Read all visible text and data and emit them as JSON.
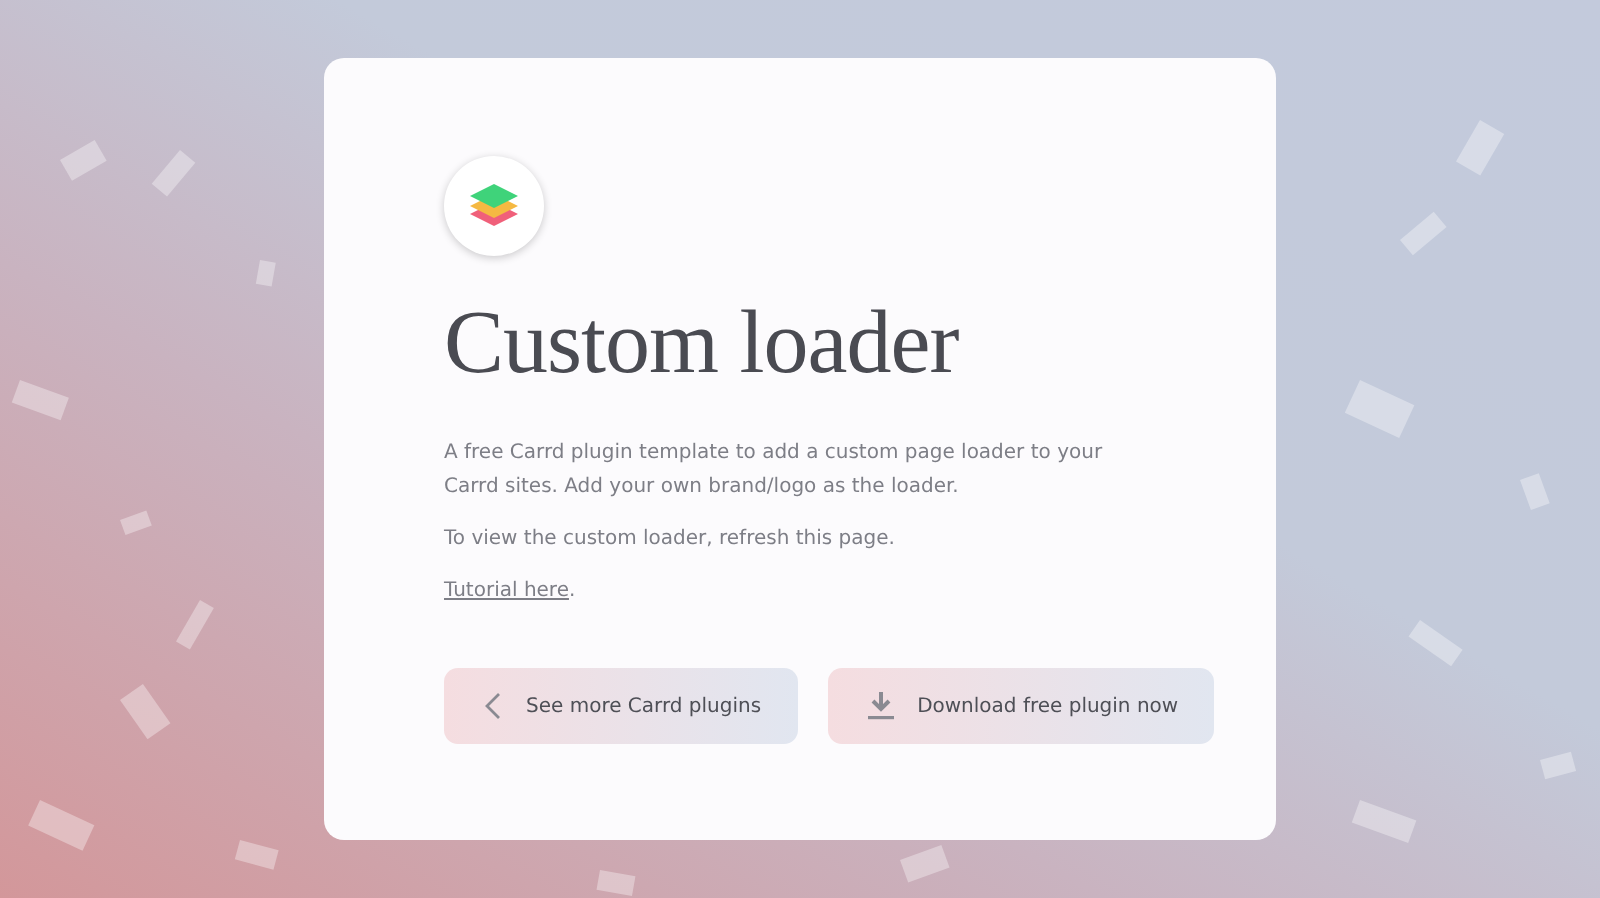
{
  "title": "Custom loader",
  "paragraphs": [
    "A free Carrd plugin template to add a custom page loader to your Carrd sites. Add your own brand/logo as the loader.",
    "To view the custom loader, refresh this page."
  ],
  "tutorial": {
    "link": "Tutorial here",
    "after": "."
  },
  "buttons": [
    {
      "kind": "back",
      "label": "See more Carrd plugins"
    },
    {
      "kind": "download",
      "label": "Download free plugin now"
    }
  ]
}
